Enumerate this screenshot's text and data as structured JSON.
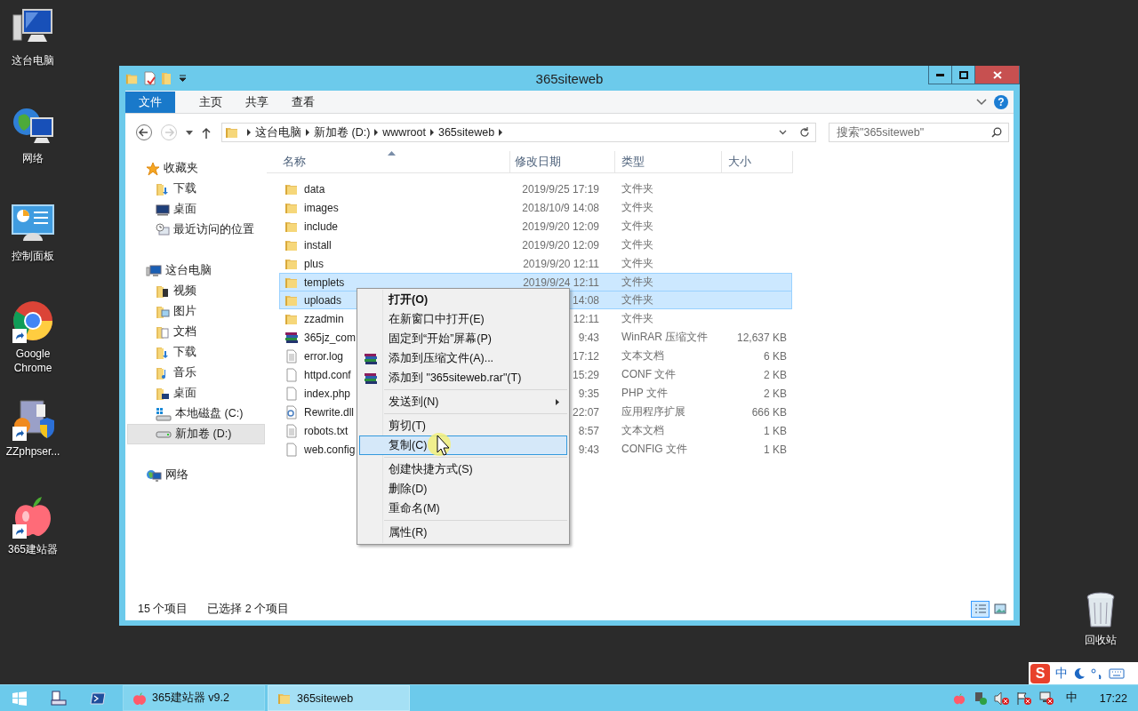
{
  "desktop_icons": [
    {
      "label": "这台电脑",
      "kind": "computer",
      "shortcut": false
    },
    {
      "label": "网络",
      "kind": "network",
      "shortcut": false
    },
    {
      "label": "控制面板",
      "kind": "control-panel",
      "shortcut": false
    },
    {
      "label": "Google Chrome",
      "kind": "chrome",
      "shortcut": true
    },
    {
      "label": "ZZphpser...",
      "kind": "server",
      "shortcut": true
    },
    {
      "label": "365建站器",
      "kind": "apple",
      "shortcut": true
    }
  ],
  "recycle_bin": {
    "label": "回收站"
  },
  "window": {
    "title": "365siteweb",
    "ribbon_tabs": [
      {
        "label": "文件",
        "kind": "file"
      },
      {
        "label": "主页",
        "kind": "tab"
      },
      {
        "label": "共享",
        "kind": "tab"
      },
      {
        "label": "查看",
        "kind": "tab"
      }
    ],
    "help": "?",
    "back_disabled": false,
    "forward_disabled": true,
    "breadcrumb": [
      "这台电脑",
      "新加卷 (D:)",
      "wwwroot",
      "365siteweb"
    ],
    "search": {
      "placeholder": "搜索\"365siteweb\""
    },
    "nav": [
      {
        "label": "收藏夹",
        "selected": false,
        "children": [
          {
            "label": "下载",
            "selected": false
          },
          {
            "label": "桌面",
            "selected": false
          },
          {
            "label": "最近访问的位置",
            "selected": false
          }
        ]
      },
      {
        "label": "这台电脑",
        "selected": false,
        "children": [
          {
            "label": "视频",
            "selected": false
          },
          {
            "label": "图片",
            "selected": false
          },
          {
            "label": "文档",
            "selected": false
          },
          {
            "label": "下载",
            "selected": false
          },
          {
            "label": "音乐",
            "selected": false
          },
          {
            "label": "桌面",
            "selected": false
          },
          {
            "label": "本地磁盘 (C:)",
            "selected": false
          },
          {
            "label": "新加卷 (D:)",
            "selected": true
          }
        ]
      },
      {
        "label": "网络",
        "selected": false
      }
    ],
    "columns": [
      "名称",
      "修改日期",
      "类型",
      "大小"
    ],
    "files": [
      {
        "name": "data",
        "date": "2019/9/25 17:19",
        "type": "文件夹",
        "kind": "folder",
        "selected": false
      },
      {
        "name": "images",
        "date": "2018/10/9 14:08",
        "type": "文件夹",
        "kind": "folder",
        "selected": false
      },
      {
        "name": "include",
        "date": "2019/9/20 12:09",
        "type": "文件夹",
        "kind": "folder",
        "selected": false
      },
      {
        "name": "install",
        "date": "2019/9/20 12:09",
        "type": "文件夹",
        "kind": "folder",
        "selected": false
      },
      {
        "name": "plus",
        "date": "2019/9/20 12:11",
        "type": "文件夹",
        "kind": "folder",
        "selected": false
      },
      {
        "name": "templets",
        "date": "2019/9/24 12:11",
        "type": "文件夹",
        "kind": "folder",
        "selected": true
      },
      {
        "name": "uploads",
        "date": "14:08",
        "type": "文件夹",
        "kind": "folder",
        "selected": true
      },
      {
        "name": "zzadmin",
        "date": "12:11",
        "type": "文件夹",
        "kind": "folder",
        "selected": false
      },
      {
        "name": "365jz_com",
        "date": "9:43",
        "type": "WinRAR 压缩文件",
        "size": "12,637 KB",
        "kind": "archive",
        "selected": false
      },
      {
        "name": "error.log",
        "date": "17:12",
        "type": "文本文档",
        "size": "6 KB",
        "kind": "text",
        "selected": false
      },
      {
        "name": "httpd.conf",
        "date": "15:29",
        "type": "CONF 文件",
        "size": "2 KB",
        "kind": "file",
        "selected": false
      },
      {
        "name": "index.php",
        "date": "9:35",
        "type": "PHP 文件",
        "size": "2 KB",
        "kind": "file",
        "selected": false
      },
      {
        "name": "Rewrite.dll",
        "date": "22:07",
        "type": "应用程序扩展",
        "size": "666 KB",
        "kind": "dll",
        "selected": false
      },
      {
        "name": "robots.txt",
        "date": "8:57",
        "type": "文本文档",
        "size": "1 KB",
        "kind": "text",
        "selected": false
      },
      {
        "name": "web.config",
        "date": "9:43",
        "type": "CONFIG 文件",
        "size": "1 KB",
        "kind": "file",
        "selected": false
      }
    ],
    "status": {
      "count": "15 个项目",
      "selection": "已选择 2 个项目"
    },
    "view_modes": [
      {
        "kind": "details",
        "selected": true
      },
      {
        "kind": "large-icons",
        "selected": false
      }
    ]
  },
  "context_menu": [
    {
      "kind": "item",
      "label": "打开(O)",
      "default": true,
      "submenu": false,
      "selected": false
    },
    {
      "kind": "item",
      "label": "在新窗口中打开(E)",
      "default": false,
      "submenu": false,
      "selected": false
    },
    {
      "kind": "item",
      "label": "固定到“开始”屏幕(P)",
      "default": false,
      "submenu": false,
      "selected": false
    },
    {
      "kind": "archive-item",
      "label": "添加到压缩文件(A)...",
      "default": false,
      "submenu": false,
      "selected": false
    },
    {
      "kind": "archive-item",
      "label": "添加到 \"365siteweb.rar\"(T)",
      "default": false,
      "submenu": false,
      "selected": false
    },
    {
      "kind": "separator"
    },
    {
      "kind": "item",
      "label": "发送到(N)",
      "default": false,
      "submenu": true,
      "selected": false
    },
    {
      "kind": "separator"
    },
    {
      "kind": "item",
      "label": "剪切(T)",
      "default": false,
      "submenu": false,
      "selected": false
    },
    {
      "kind": "item",
      "label": "复制(C)",
      "default": false,
      "submenu": false,
      "selected": true
    },
    {
      "kind": "separator"
    },
    {
      "kind": "item",
      "label": "创建快捷方式(S)",
      "default": false,
      "submenu": false,
      "selected": false
    },
    {
      "kind": "item",
      "label": "删除(D)",
      "default": false,
      "submenu": false,
      "selected": false
    },
    {
      "kind": "item",
      "label": "重命名(M)",
      "default": false,
      "submenu": false,
      "selected": false
    },
    {
      "kind": "separator"
    },
    {
      "kind": "item",
      "label": "属性(R)",
      "default": false,
      "submenu": false,
      "selected": false
    }
  ],
  "ime": {
    "logo": "S",
    "mode": "中"
  },
  "taskbar": {
    "tasks": [
      {
        "label": "365建站器 v9.2",
        "kind": "apple",
        "selected": false
      },
      {
        "label": "365siteweb",
        "kind": "folder",
        "selected": true
      }
    ],
    "input_mode": "中",
    "clock": "17:22"
  }
}
